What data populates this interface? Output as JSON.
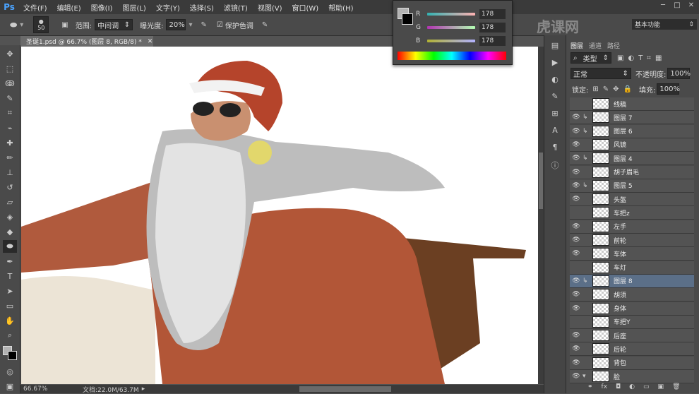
{
  "app": {
    "logo": "Ps"
  },
  "menu": [
    "文件(F)",
    "编辑(E)",
    "图像(I)",
    "图层(L)",
    "文字(Y)",
    "选择(S)",
    "滤镜(T)",
    "视图(V)",
    "窗口(W)",
    "帮助(H)"
  ],
  "options": {
    "brush_size": "50",
    "range_label": "范围:",
    "range_value": "中间调",
    "exposure_label": "曝光度:",
    "exposure_value": "20%",
    "protect_label": "保护色调"
  },
  "doc_tab": "圣诞1.psd @ 66.7% (图层 8, RGB/8) *",
  "status": {
    "zoom": "66.67%",
    "doc": "文档:22.0M/63.7M"
  },
  "color_panel": {
    "r_label": "R",
    "r_value": "178",
    "g_label": "G",
    "g_value": "178",
    "b_label": "B",
    "b_value": "178"
  },
  "watermark": "虎课网",
  "workspace": "基本功能",
  "layers_panel": {
    "tabs": [
      "图层",
      "通道",
      "路径"
    ],
    "filter": "类型",
    "blend_mode": "正常",
    "opacity_label": "不透明度:",
    "opacity_value": "100%",
    "lock_label": "锁定:",
    "fill_label": "填充:",
    "fill_value": "100%",
    "layers": [
      {
        "name": "线稿",
        "visible": false,
        "clipped": false
      },
      {
        "name": "图层 7",
        "visible": true,
        "clipped": true
      },
      {
        "name": "图层 6",
        "visible": true,
        "clipped": true
      },
      {
        "name": "风镜",
        "visible": true,
        "clipped": false
      },
      {
        "name": "图层 4",
        "visible": true,
        "clipped": true
      },
      {
        "name": "胡子眉毛",
        "visible": true,
        "clipped": false
      },
      {
        "name": "图层 5",
        "visible": true,
        "clipped": true
      },
      {
        "name": "头盔",
        "visible": true,
        "clipped": false
      },
      {
        "name": "车把z",
        "visible": false,
        "clipped": false
      },
      {
        "name": "左手",
        "visible": true,
        "clipped": false
      },
      {
        "name": "前轮",
        "visible": true,
        "clipped": false
      },
      {
        "name": "车体",
        "visible": true,
        "clipped": false
      },
      {
        "name": "车灯",
        "visible": false,
        "clipped": false
      },
      {
        "name": "图层 8",
        "visible": true,
        "clipped": true,
        "selected": true
      },
      {
        "name": "胡须",
        "visible": true,
        "clipped": false
      },
      {
        "name": "身体",
        "visible": true,
        "clipped": false
      },
      {
        "name": "车把Y",
        "visible": false,
        "clipped": false
      },
      {
        "name": "后座",
        "visible": true,
        "clipped": false
      },
      {
        "name": "后轮",
        "visible": true,
        "clipped": false
      },
      {
        "name": "背包",
        "visible": true,
        "clipped": false
      },
      {
        "name": "脸",
        "visible": true,
        "clipped": false,
        "group": true
      }
    ]
  }
}
